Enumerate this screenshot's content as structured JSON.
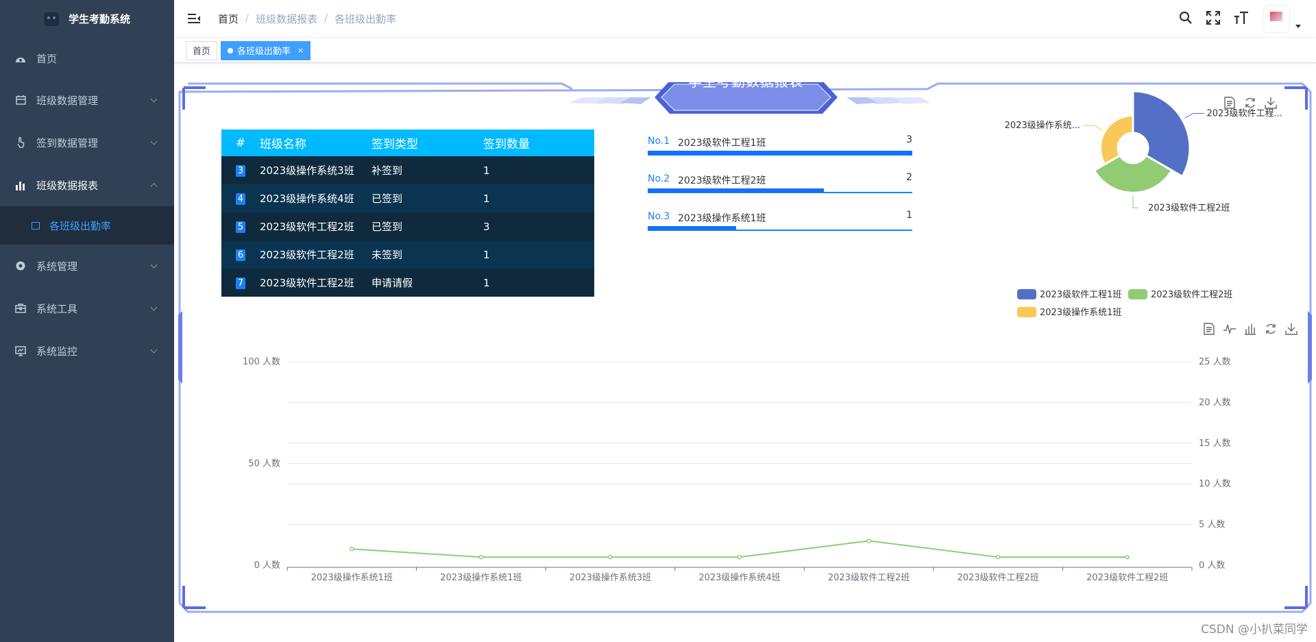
{
  "app": {
    "title": "学生考勤系统"
  },
  "sidebar": {
    "items": [
      {
        "label": "首页",
        "icon": "dashboard-icon",
        "has_children": false
      },
      {
        "label": "班级数据管理",
        "icon": "calendar-icon",
        "has_children": true
      },
      {
        "label": "签到数据管理",
        "icon": "hand-pointer-icon",
        "has_children": true
      },
      {
        "label": "班级数据报表",
        "icon": "bar-chart-icon",
        "has_children": true,
        "expanded": true
      },
      {
        "label": "系统管理",
        "icon": "gear-icon",
        "has_children": true
      },
      {
        "label": "系统工具",
        "icon": "toolbox-icon",
        "has_children": true
      },
      {
        "label": "系统监控",
        "icon": "monitor-icon",
        "has_children": true
      }
    ],
    "active_sub_item": {
      "label": "各班级出勤率",
      "icon": "report-icon"
    }
  },
  "header": {
    "breadcrumb": [
      "首页",
      "班级数据报表",
      "各班级出勤率"
    ],
    "separator": "/"
  },
  "tags": {
    "items": [
      {
        "label": "首页",
        "active": false
      },
      {
        "label": "各班级出勤率",
        "active": true,
        "close": "×"
      }
    ]
  },
  "report": {
    "title": "学生考勤数据报表",
    "table": {
      "headers": [
        "#",
        "班级名称",
        "签到类型",
        "签到数量"
      ],
      "rows": [
        {
          "idx": "3",
          "name": "2023级操作系统3班",
          "type": "补签到",
          "count": "1"
        },
        {
          "idx": "4",
          "name": "2023级操作系统4班",
          "type": "已签到",
          "count": "1"
        },
        {
          "idx": "5",
          "name": "2023级软件工程2班",
          "type": "已签到",
          "count": "3"
        },
        {
          "idx": "6",
          "name": "2023级软件工程2班",
          "type": "未签到",
          "count": "1"
        },
        {
          "idx": "7",
          "name": "2023级软件工程2班",
          "type": "申请请假",
          "count": "1"
        }
      ]
    },
    "ranking": [
      {
        "no": "No.1",
        "name": "2023级软件工程1班",
        "value": "3"
      },
      {
        "no": "No.2",
        "name": "2023级软件工程2班",
        "value": "2"
      },
      {
        "no": "No.3",
        "name": "2023级操作系统1班",
        "value": "1"
      }
    ]
  },
  "colors": {
    "pie1": "#5470c6",
    "pie2": "#91cc75",
    "pie3": "#fac858",
    "accent": "#409eff",
    "sidebar_bg": "#304156"
  },
  "watermark": "CSDN @小扒菜同学",
  "chart_data": [
    {
      "type": "pie",
      "variant": "rose",
      "series": [
        {
          "name": "2023级软件工程1班",
          "value": 3,
          "label": "2023级软件工程..."
        },
        {
          "name": "2023级软件工程2班",
          "value": 2,
          "label": "2023级软件工程2班"
        },
        {
          "name": "2023级操作系统1班",
          "value": 1,
          "label": "2023级操作系统..."
        }
      ],
      "legend": [
        "2023级软件工程1班",
        "2023级软件工程2班",
        "2023级操作系统1班"
      ],
      "legend_position": "bottom"
    },
    {
      "type": "line",
      "categories": [
        "2023级操作系统1班",
        "2023级操作系统1班",
        "2023级操作系统3班",
        "2023级操作系统4班",
        "2023级软件工程2班",
        "2023级软件工程2班",
        "2023级软件工程2班"
      ],
      "values": [
        2,
        1,
        1,
        1,
        3,
        1,
        1
      ],
      "y_left": {
        "ticks": [
          "0 人数",
          "50 人数",
          "100 人数"
        ],
        "range": [
          0,
          100
        ]
      },
      "y_right": {
        "ticks": [
          "0 人数",
          "5 人数",
          "10 人数",
          "15 人数",
          "20 人数",
          "25 人数"
        ],
        "range": [
          0,
          25
        ]
      },
      "series_axis": "right",
      "color": "#91cc75",
      "grid": true
    }
  ]
}
